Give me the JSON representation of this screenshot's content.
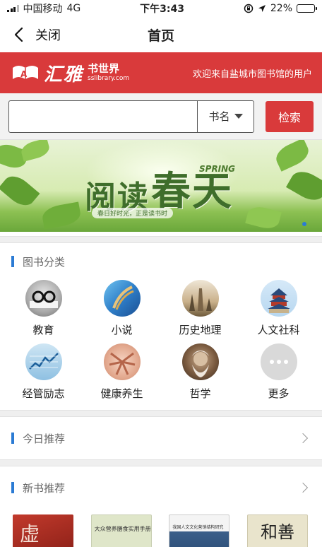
{
  "status_bar": {
    "carrier": "中国移动",
    "network": "4G",
    "time": "下午3:43",
    "battery": "22%",
    "battery_level": 0.22
  },
  "nav": {
    "close_label": "关闭",
    "title": "首页"
  },
  "brand": {
    "logo_text": "汇雅",
    "logo_sub_cn": "书世界",
    "logo_sub_en": "sslibrary.com",
    "welcome": "欢迎来自盐城市图书馆的用户"
  },
  "search": {
    "value": "",
    "placeholder": "",
    "type_selected": "书名",
    "button_label": "检索"
  },
  "banner": {
    "headline_1": "阅读",
    "headline_2": "春天",
    "spring_en": "SPRING",
    "slogan": "春日好时光，正是读书时",
    "active_slide": 1
  },
  "categories": {
    "title": "图书分类",
    "items": [
      {
        "label": "教育",
        "icon": "education-icon"
      },
      {
        "label": "小说",
        "icon": "novel-icon"
      },
      {
        "label": "历史地理",
        "icon": "history-geography-icon"
      },
      {
        "label": "人文社科",
        "icon": "humanities-icon"
      },
      {
        "label": "经管励志",
        "icon": "economics-icon"
      },
      {
        "label": "健康养生",
        "icon": "health-icon"
      },
      {
        "label": "哲学",
        "icon": "philosophy-icon"
      },
      {
        "label": "更多",
        "icon": "more-icon"
      }
    ]
  },
  "today_recommend": {
    "title": "今日推荐"
  },
  "new_books": {
    "title": "新书推荐",
    "items": [
      {
        "cover_text": "虚"
      },
      {
        "cover_text": "大众营养膳食实用手册"
      },
      {
        "cover_text": "我国人文文化营销结构研究"
      },
      {
        "cover_text": "和善"
      }
    ]
  },
  "colors": {
    "brand_red": "#d93a3b",
    "accent_blue": "#2b7bd4"
  }
}
